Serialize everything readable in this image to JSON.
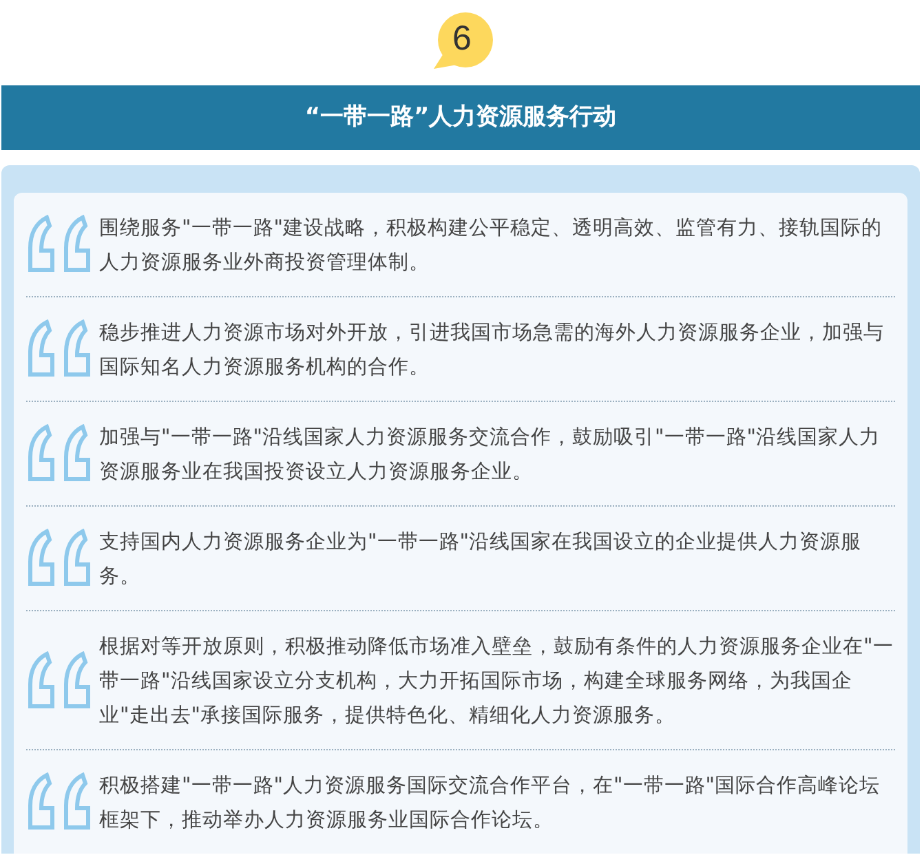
{
  "badge": {
    "number": "6"
  },
  "banner": {
    "title": "“一带一路”人力资源服务行动"
  },
  "items": [
    {
      "text": "围绕服务\"一带一路\"建设战略，积极构建公平稳定、透明高效、监管有力、接轨国际的人力资源服务业外商投资管理体制。"
    },
    {
      "text": "稳步推进人力资源市场对外开放，引进我国市场急需的海外人力资源服务企业，加强与国际知名人力资源服务机构的合作。"
    },
    {
      "text": "加强与\"一带一路\"沿线国家人力资源服务交流合作，鼓励吸引\"一带一路\"沿线国家人力资源服务业在我国投资设立人力资源服务企业。"
    },
    {
      "text": "支持国内人力资源服务企业为\"一带一路\"沿线国家在我国设立的企业提供人力资源服务。"
    },
    {
      "text": "根据对等开放原则，积极推动降低市场准入壁垒，鼓励有条件的人力资源服务企业在\"一带一路\"沿线国家设立分支机构，大力开拓国际市场，构建全球服务网络，为我国企业\"走出去\"承接国际服务，提供特色化、精细化人力资源服务。"
    },
    {
      "text": "积极搭建\"一带一路\"人力资源服务国际交流合作平台，在\"一带一路\"国际合作高峰论坛框架下，推动举办人力资源服务业国际合作论坛。"
    }
  ]
}
